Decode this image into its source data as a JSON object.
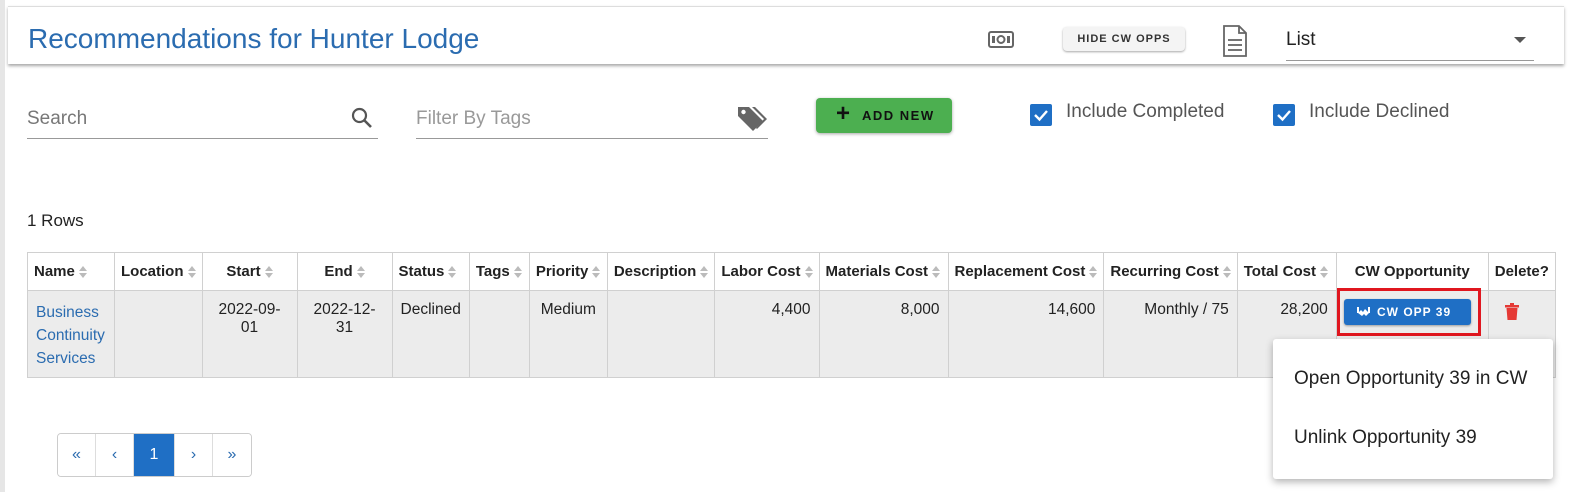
{
  "header": {
    "title": "Recommendations for Hunter Lodge",
    "hide_cw_opps_label": "HIDE CW OPPS",
    "view_select": {
      "value": "List"
    }
  },
  "filters": {
    "search_placeholder": "Search",
    "tags_placeholder": "Filter By Tags",
    "add_new_label": "ADD NEW",
    "include_completed": {
      "label": "Include Completed",
      "checked": true
    },
    "include_declined": {
      "label": "Include Declined",
      "checked": true
    }
  },
  "rows_count": "1 Rows",
  "table": {
    "columns": [
      "Name",
      "Location",
      "Start",
      "End",
      "Status",
      "Tags",
      "Priority",
      "Description",
      "Labor Cost",
      "Materials Cost",
      "Replacement Cost",
      "Recurring Cost",
      "Total Cost",
      "CW Opportunity",
      "Delete?"
    ],
    "rows": [
      {
        "name_lines": [
          "Business",
          "Continuity",
          "Services"
        ],
        "location": "",
        "start": "2022-09-01",
        "end": "2022-12-31",
        "status": "Declined",
        "tags": "",
        "priority": "Medium",
        "description": "",
        "labor_cost": "4,400",
        "materials_cost": "8,000",
        "replacement_cost": "14,600",
        "recurring_cost": "Monthly / 75",
        "total_cost": "28,200",
        "cw_opportunity_label": "CW OPP 39"
      }
    ]
  },
  "context_menu": {
    "items": [
      "Open Opportunity 39 in CW",
      "Unlink Opportunity 39"
    ]
  },
  "pagination": {
    "first": "«",
    "prev": "‹",
    "current": "1",
    "next": "›",
    "last": "»"
  },
  "colors": {
    "accent": "#1f6fc5",
    "title": "#2b6cb0",
    "add_button": "#4caf50",
    "highlight": "#e0161f",
    "delete": "#e53935"
  },
  "icons": [
    "cash-icon",
    "document-icon",
    "search-icon",
    "tag-icon",
    "plus-icon",
    "check-icon",
    "handshake-icon",
    "trash-icon"
  ]
}
